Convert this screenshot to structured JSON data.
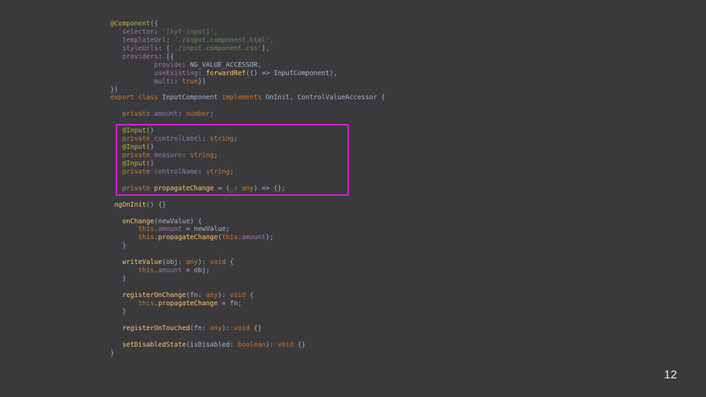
{
  "colors": {
    "background": "#3a3a3d",
    "highlight_border": "#e020e0",
    "plain": "#a9b7c6",
    "keyword": "#cc7832",
    "string": "#6a8759",
    "annotation": "#bbb529",
    "function": "#ffc66d",
    "field": "#9876aa",
    "text_muted": "#7e7e7e"
  },
  "slide_number": "12",
  "code_lines": [
    [
      [
        "a",
        "@Component"
      ],
      [
        "p",
        "({"
      ]
    ],
    [
      [
        "p",
        "   "
      ],
      [
        "v",
        "selector"
      ],
      [
        "p",
        ": "
      ],
      [
        "s",
        "'[kyf-input]',"
      ]
    ],
    [
      [
        "p",
        "   "
      ],
      [
        "v",
        "templateUrl"
      ],
      [
        "p",
        ": "
      ],
      [
        "s",
        "'./input.component.html',"
      ]
    ],
    [
      [
        "p",
        "   "
      ],
      [
        "v",
        "styleUrls"
      ],
      [
        "p",
        ": ["
      ],
      [
        "s",
        "'./input.component.css'"
      ],
      [
        "p",
        "],"
      ]
    ],
    [
      [
        "p",
        "   "
      ],
      [
        "v",
        "providers"
      ],
      [
        "p",
        ": [{"
      ]
    ],
    [
      [
        "p",
        "           "
      ],
      [
        "v",
        "provide"
      ],
      [
        "p",
        ": NG_VALUE_ACCESSOR,"
      ]
    ],
    [
      [
        "p",
        "           "
      ],
      [
        "v",
        "useExisting"
      ],
      [
        "p",
        ": "
      ],
      [
        "f",
        "forwardRef"
      ],
      [
        "p",
        "(() => InputComponent),"
      ]
    ],
    [
      [
        "p",
        "           "
      ],
      [
        "v",
        "multi"
      ],
      [
        "p",
        ": "
      ],
      [
        "k",
        "true"
      ],
      [
        "p",
        "}]"
      ]
    ],
    [
      [
        "p",
        "})"
      ]
    ],
    [
      [
        "k",
        "export class "
      ],
      [
        "p",
        "InputComponent "
      ],
      [
        "k",
        "implements "
      ],
      [
        "p",
        "OnInit, ControlValueAccessor {"
      ]
    ],
    [
      [
        "p",
        ""
      ]
    ],
    [
      [
        "p",
        "   "
      ],
      [
        "k",
        "private "
      ],
      [
        "v",
        "amount"
      ],
      [
        "p",
        ": "
      ],
      [
        "k",
        "number"
      ],
      [
        "p",
        ";"
      ]
    ],
    [
      [
        "p",
        ""
      ]
    ],
    [
      [
        "p",
        "   "
      ],
      [
        "a",
        "@Input"
      ],
      [
        "p",
        "()"
      ]
    ],
    [
      [
        "p",
        "   "
      ],
      [
        "k",
        "private "
      ],
      [
        "v",
        "controlLabel"
      ],
      [
        "p",
        ": "
      ],
      [
        "k",
        "string"
      ],
      [
        "p",
        ";"
      ]
    ],
    [
      [
        "p",
        "   "
      ],
      [
        "a",
        "@Input"
      ],
      [
        "p",
        "()"
      ]
    ],
    [
      [
        "p",
        "   "
      ],
      [
        "k",
        "private "
      ],
      [
        "v",
        "measure"
      ],
      [
        "p",
        ": "
      ],
      [
        "k",
        "string"
      ],
      [
        "p",
        ";"
      ]
    ],
    [
      [
        "p",
        "   "
      ],
      [
        "a",
        "@Input"
      ],
      [
        "p",
        "()"
      ]
    ],
    [
      [
        "p",
        "   "
      ],
      [
        "k",
        "private "
      ],
      [
        "v",
        "controlName"
      ],
      [
        "p",
        ": "
      ],
      [
        "k",
        "string"
      ],
      [
        "p",
        ";"
      ]
    ],
    [
      [
        "p",
        ""
      ]
    ],
    [
      [
        "p",
        "   "
      ],
      [
        "k",
        "private "
      ],
      [
        "f",
        "propagateChange"
      ],
      [
        "p",
        " = (_: "
      ],
      [
        "k",
        "any"
      ],
      [
        "p",
        ") => {};"
      ]
    ],
    [
      [
        "p",
        ""
      ]
    ],
    [
      [
        "p",
        " "
      ],
      [
        "f",
        "ngOnInit"
      ],
      [
        "p",
        "() {}"
      ]
    ],
    [
      [
        "p",
        ""
      ]
    ],
    [
      [
        "p",
        "   "
      ],
      [
        "f",
        "onChange"
      ],
      [
        "p",
        "(newValue) {"
      ]
    ],
    [
      [
        "p",
        "       "
      ],
      [
        "k",
        "this"
      ],
      [
        "p",
        "."
      ],
      [
        "v",
        "amount"
      ],
      [
        "p",
        " = newValue;"
      ]
    ],
    [
      [
        "p",
        "       "
      ],
      [
        "k",
        "this"
      ],
      [
        "p",
        "."
      ],
      [
        "f",
        "propagateChange"
      ],
      [
        "p",
        "("
      ],
      [
        "k",
        "this"
      ],
      [
        "p",
        "."
      ],
      [
        "v",
        "amount"
      ],
      [
        "p",
        ");"
      ]
    ],
    [
      [
        "p",
        "   }"
      ]
    ],
    [
      [
        "p",
        ""
      ]
    ],
    [
      [
        "p",
        "   "
      ],
      [
        "f",
        "writeValue"
      ],
      [
        "p",
        "(obj: "
      ],
      [
        "k",
        "any"
      ],
      [
        "p",
        "): "
      ],
      [
        "k",
        "void"
      ],
      [
        "p",
        " {"
      ]
    ],
    [
      [
        "p",
        "       "
      ],
      [
        "k",
        "this"
      ],
      [
        "p",
        "."
      ],
      [
        "v",
        "amount"
      ],
      [
        "p",
        " = obj;"
      ]
    ],
    [
      [
        "p",
        "   }"
      ]
    ],
    [
      [
        "p",
        ""
      ]
    ],
    [
      [
        "p",
        "   "
      ],
      [
        "f",
        "registerOnChange"
      ],
      [
        "p",
        "(fn: "
      ],
      [
        "k",
        "any"
      ],
      [
        "p",
        "): "
      ],
      [
        "k",
        "void"
      ],
      [
        "p",
        " {"
      ]
    ],
    [
      [
        "p",
        "       "
      ],
      [
        "k",
        "this"
      ],
      [
        "p",
        "."
      ],
      [
        "f",
        "propagateChange"
      ],
      [
        "p",
        " = fn;"
      ]
    ],
    [
      [
        "p",
        "   }"
      ]
    ],
    [
      [
        "p",
        ""
      ]
    ],
    [
      [
        "p",
        "   "
      ],
      [
        "f",
        "registerOnTouched"
      ],
      [
        "p",
        "(fn: "
      ],
      [
        "k",
        "any"
      ],
      [
        "p",
        "): "
      ],
      [
        "k",
        "void"
      ],
      [
        "p",
        " {}"
      ]
    ],
    [
      [
        "p",
        ""
      ]
    ],
    [
      [
        "p",
        "   "
      ],
      [
        "f",
        "setDisabledState"
      ],
      [
        "p",
        "(isDisabled: "
      ],
      [
        "k",
        "boolean"
      ],
      [
        "p",
        "): "
      ],
      [
        "k",
        "void"
      ],
      [
        "p",
        " {}"
      ]
    ],
    [
      [
        "p",
        "}"
      ]
    ]
  ]
}
